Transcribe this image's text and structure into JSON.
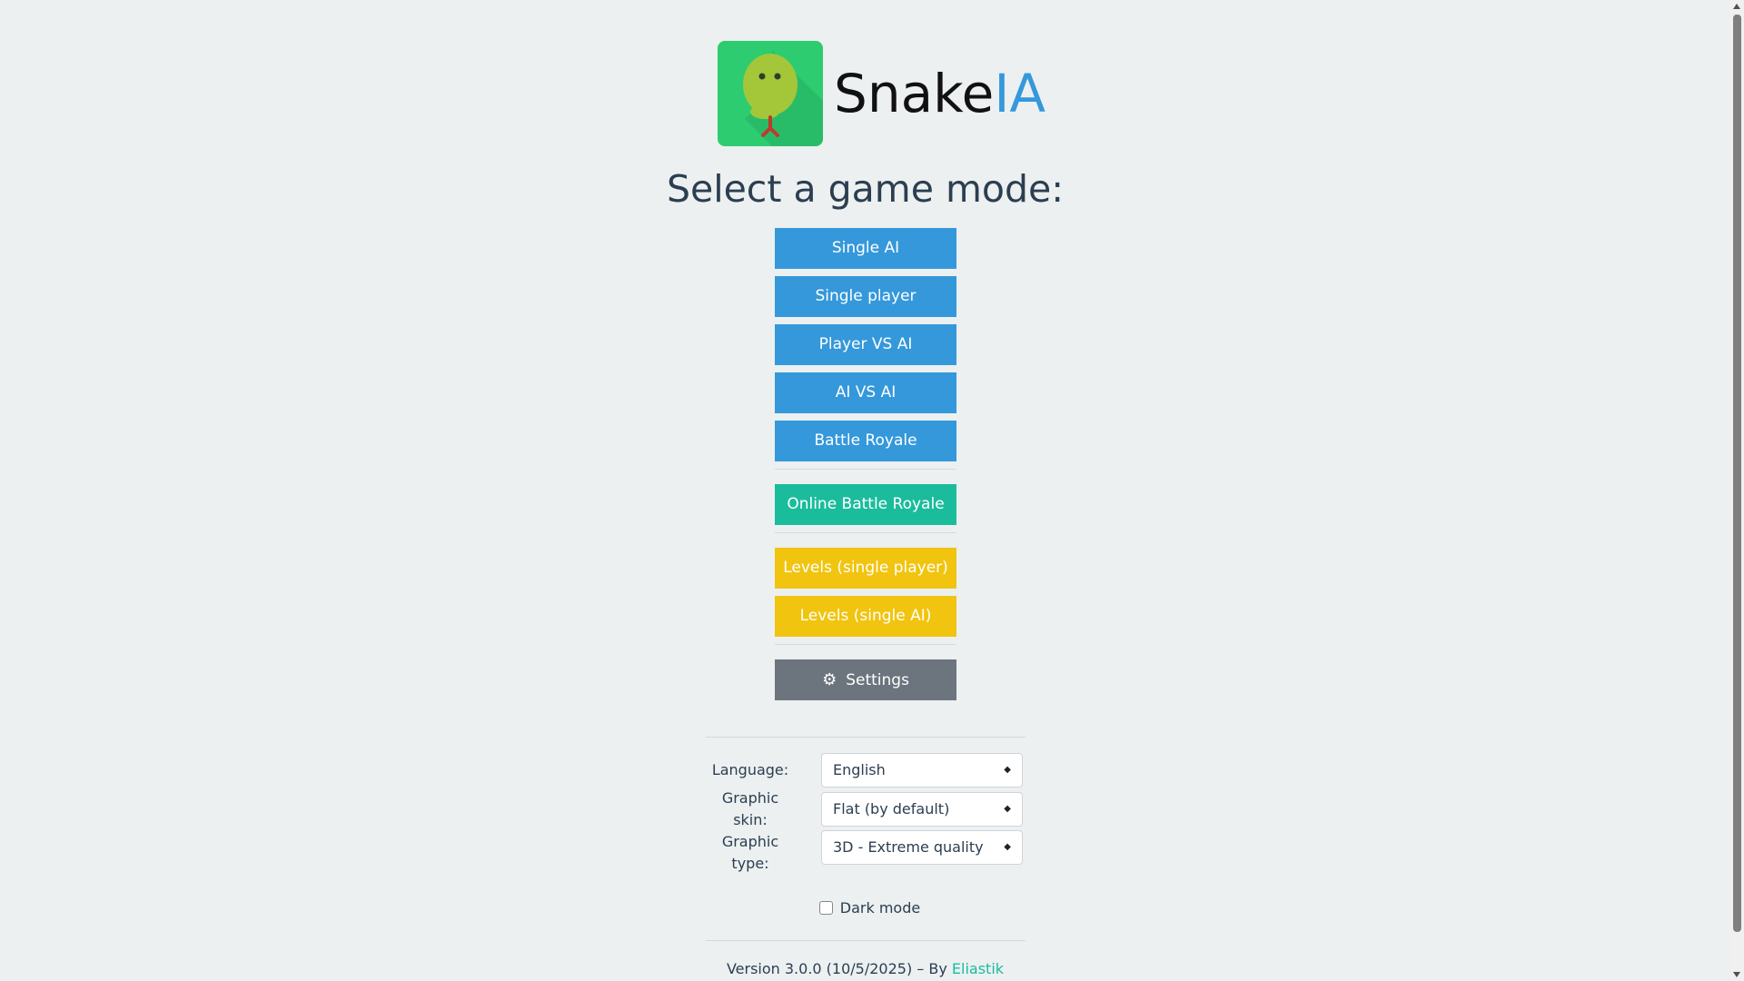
{
  "logo": {
    "text_main": "Snake",
    "text_accent": "IA"
  },
  "title": "Select a game mode:",
  "modes": {
    "single_ai": "Single AI",
    "single_player": "Single player",
    "player_vs_ai": "Player VS AI",
    "ai_vs_ai": "AI VS AI",
    "battle_royale": "Battle Royale",
    "online_battle_royale": "Online Battle Royale",
    "levels_single_player": "Levels (single player)",
    "levels_single_ai": "Levels (single AI)",
    "settings": "Settings"
  },
  "options": {
    "language_label": "Language:",
    "language_value": "English",
    "skin_label": "Graphic skin:",
    "skin_value": "Flat (by default)",
    "type_label": "Graphic type:",
    "type_value": "3D - Extreme quality",
    "dark_mode_label": "Dark mode",
    "dark_mode_checked": false
  },
  "footer": {
    "version_text": "Version 3.0.0 (10/5/2025) – By ",
    "author": "Eliastik"
  },
  "colors": {
    "background": "#ecf0f1",
    "blue": "#3498db",
    "teal": "#1abc9c",
    "yellow": "#f1c40f",
    "gray": "#6c757d",
    "logo_green": "#2ecc71",
    "snake_head": "#a4c639"
  },
  "icons": {
    "settings": "gear-icon",
    "select_caret": "sort-caret-icon"
  }
}
